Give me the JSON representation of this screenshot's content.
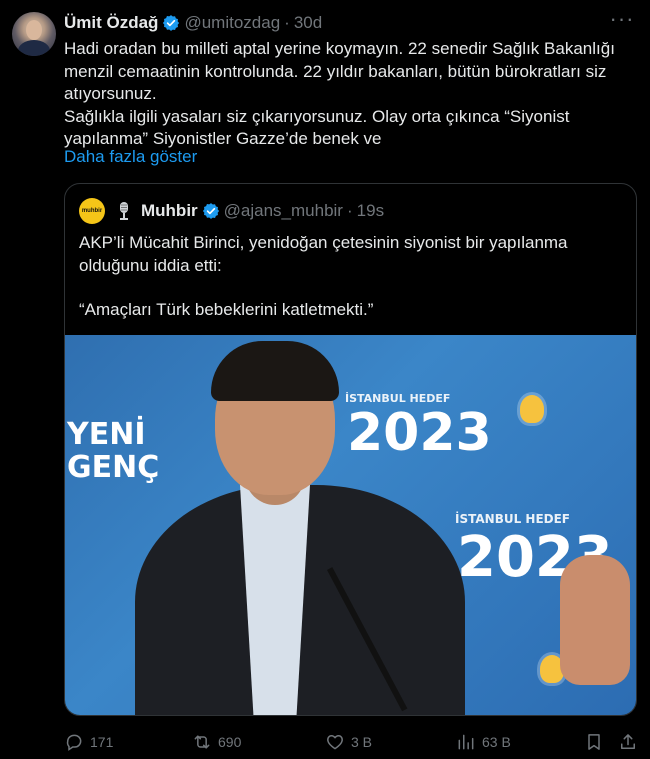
{
  "tweet": {
    "display_name": "Ümit Özdağ",
    "handle": "@umitozdag",
    "separator": "·",
    "time": "30d",
    "more_icon": "more-icon",
    "body_line1": "Hadi oradan bu milleti aptal yerine koymayın. 22 senedir Sağlık Bakanlığı menzil cemaatinin kontrolunda. 22 yıldır bakanları, bütün bürokratları siz atıyorsunuz.",
    "body_line2": "Sağlıkla ilgili yasaları siz çıkarıyorsunuz. Olay orta çıkınca “Siyonist yapılanma” Siyonistler Gazze’de benek ve",
    "show_more": "Daha fazla göster"
  },
  "quote": {
    "avatar_text": "muhbir",
    "display_name": "Muhbir",
    "handle": "@ajans_muhbir",
    "separator": "·",
    "time": "19s",
    "text1": "AKP’li Mücahit Birinci, yenidoğan çetesinin siyonist bir yapılanma olduğunu iddia etti:",
    "text2": "“Amaçları Türk bebeklerini katletmekti.”",
    "image": {
      "poster_left_line1": "YENİ",
      "poster_left_line2": "GENÇ",
      "poster_year_top": "2023",
      "poster_year_bottom": "2023",
      "poster_caption_top": "İSTANBUL HEDEF",
      "poster_caption_bottom": "İSTANBUL HEDEF"
    }
  },
  "actions": {
    "replies": "171",
    "reposts": "690",
    "likes": "3 B",
    "views": "63 B"
  },
  "colors": {
    "background": "#000000",
    "text": "#e7e9ea",
    "muted": "#71767b",
    "link": "#1d9bf0",
    "verified": "#1d9bf0"
  }
}
